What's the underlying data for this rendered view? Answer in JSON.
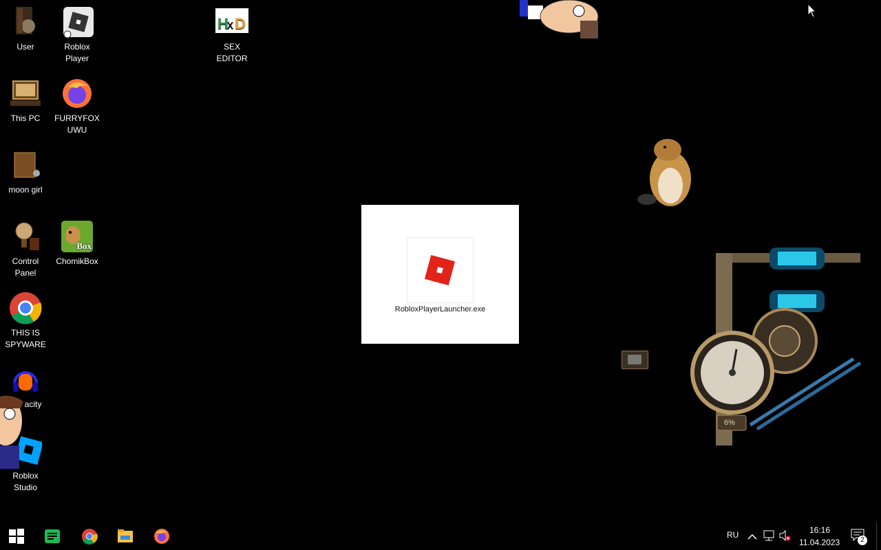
{
  "desktop": {
    "icons": [
      {
        "label": "User"
      },
      {
        "label": "Roblox Player"
      },
      {
        "label": "SEX EDITOR"
      },
      {
        "label": "This PC"
      },
      {
        "label": "FURRYFOX UWU"
      },
      {
        "label": "moon girl"
      },
      {
        "label": "Control Panel"
      },
      {
        "label": "ChomikBox"
      },
      {
        "label": "THIS IS SPYWARE"
      },
      {
        "label": "acity"
      },
      {
        "label": "Roblox Studio"
      }
    ],
    "chomikbox_badge": "Box",
    "hxd_letters": "HxD"
  },
  "splash": {
    "filename": "RobloxPlayerLauncher.exe"
  },
  "gadget": {
    "gauge_percent_label": "6%",
    "gauge_value": 0.06
  },
  "taskbar": {
    "language": "RU",
    "time": "16:16",
    "date": "11.04.2023",
    "notification_count": "2",
    "icons": [
      "start-icon",
      "notes-icon",
      "chrome-icon",
      "file-explorer-icon",
      "firefox-icon"
    ]
  },
  "colors": {
    "roblox_red": "#e2231a",
    "desktop_bg": "#000000"
  }
}
